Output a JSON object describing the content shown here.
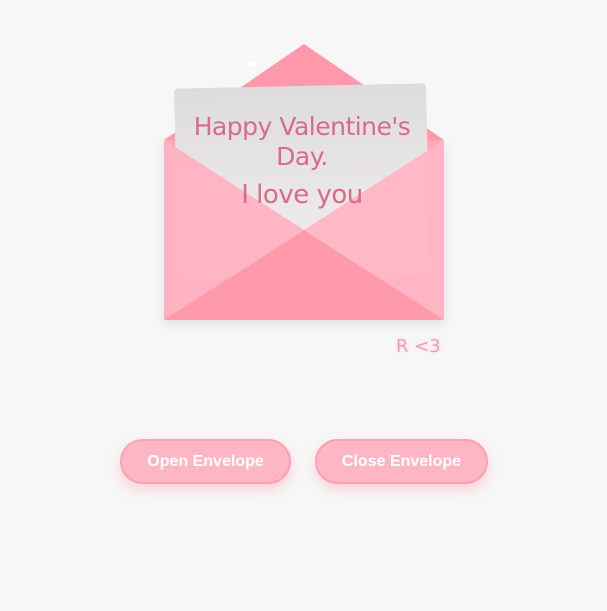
{
  "letter": {
    "line1": "Happy Valentine's Day.",
    "line2": "I love you"
  },
  "signature": "R <3",
  "buttons": {
    "open_label": "Open Envelope",
    "close_label": "Close Envelope"
  },
  "colors": {
    "background": "#f7f7f7",
    "flap": "#ff9aae",
    "envelope_body": "#ffb3c1",
    "button_fill": "#ffb6c4",
    "text_pink": "#d96a8a"
  }
}
